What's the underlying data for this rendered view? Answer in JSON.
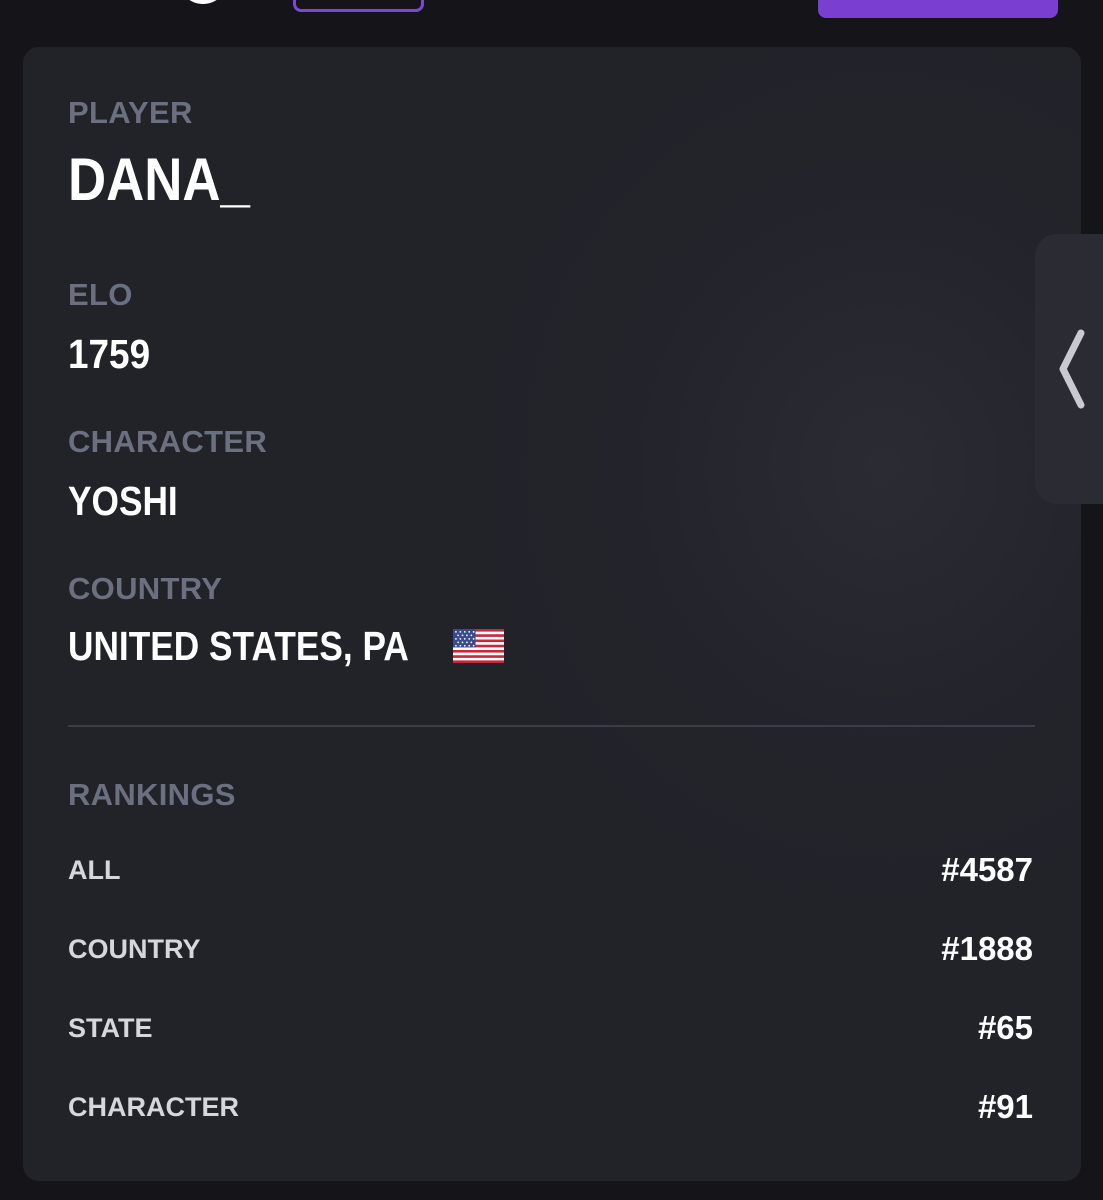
{
  "player": {
    "label": "PLAYER",
    "name": "DANA_"
  },
  "elo": {
    "label": "ELO",
    "value": "1759"
  },
  "character": {
    "label": "CHARACTER",
    "value": "YOSHI"
  },
  "country": {
    "label": "COUNTRY",
    "value": "UNITED STATES, PA",
    "flag_icon": "us-flag-icon"
  },
  "rankings": {
    "label": "RANKINGS",
    "rows": [
      {
        "label": "ALL",
        "value": "#4587"
      },
      {
        "label": "COUNTRY",
        "value": "#1888"
      },
      {
        "label": "STATE",
        "value": "#65"
      },
      {
        "label": "CHARACTER",
        "value": "#91"
      }
    ]
  },
  "colors": {
    "accent": "#7a3fd0",
    "card": "#23242b",
    "background": "#141419",
    "label": "#6b7080"
  },
  "side_tab": {
    "icon": "chevron-left-icon"
  }
}
